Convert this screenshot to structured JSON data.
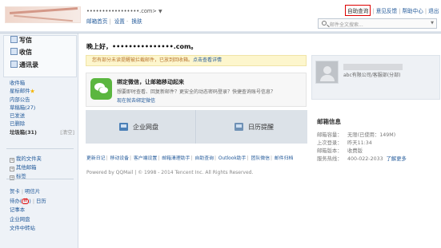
{
  "header": {
    "account_address": "•••••••••••••••••.com>",
    "dropdown_icon": "▼",
    "sub_links": [
      "邮箱首页",
      "设置",
      "换肤"
    ],
    "top_links": [
      "自助查询",
      "意见反馈",
      "帮助中心",
      "退出"
    ],
    "search_placeholder": "邮件全文搜索..."
  },
  "sidebar": {
    "write": "写信",
    "receive": "收信",
    "contacts": "通讯录",
    "folders": {
      "inbox": "收件箱",
      "starred": "星标邮件",
      "internal": "内部公告",
      "drafts": "草稿箱(27)",
      "sent": "已发送",
      "deleted": "已删除",
      "ads": "垃圾箱(31)",
      "clear": "[清空]"
    },
    "sections": {
      "my_folders": "我的文件夹",
      "other_mailboxes": "其他邮箱",
      "tags": "标签"
    },
    "tools": {
      "attachments": "贺卡",
      "postcards": "明信片",
      "todo": "待办",
      "todo_badge": "新",
      "calendar": "日历",
      "notes": "记事本",
      "netdisk": "企业网盘",
      "transfer": "文件中转站"
    }
  },
  "main": {
    "greeting": "晚上好，•••••••••••••••.com。",
    "notice": "您有部分未读提醒被拦截邮件，已放到回收箱。",
    "notice_link": "点击查看详情",
    "bind_title": "绑定微信，让邮箱移动起来",
    "bind_desc": "想要即时查看、回复新邮件？更安全的动态密码登录？快捷查询账号信息？",
    "bind_link": "现在就去绑定微信",
    "app_netdisk": "企业网盘",
    "app_calendar": "日历提醒",
    "footer_links": [
      "更新日记",
      "移动设备",
      "客户端设置",
      "邮箱清理助手",
      "自助查询",
      "Outlook助手",
      "团队微信",
      "邮件归档"
    ],
    "copyright": "Powered by QQMail | © 1998 - 2014 Tencent Inc. All Rights Reserved."
  },
  "profile": {
    "name": "•••••••••",
    "company": "abc有限公司/客服部(分部)"
  },
  "mail_info": {
    "title": "邮箱信息",
    "capacity_label": "邮箱容量：",
    "capacity_value": "无限(已使用：149M)",
    "login_label": "上次登录：",
    "login_value": "昨天11:34",
    "version_label": "邮箱版本：",
    "version_value": "收费版",
    "hotline_label": "服务热线：",
    "hotline_value": "400-022-2033",
    "more_link": "了解更多"
  },
  "colors": {
    "link": "#235a9a",
    "highlight_border": "#d00000",
    "notice_bg": "#fdf6cd",
    "wechat": "#5bb63f"
  }
}
